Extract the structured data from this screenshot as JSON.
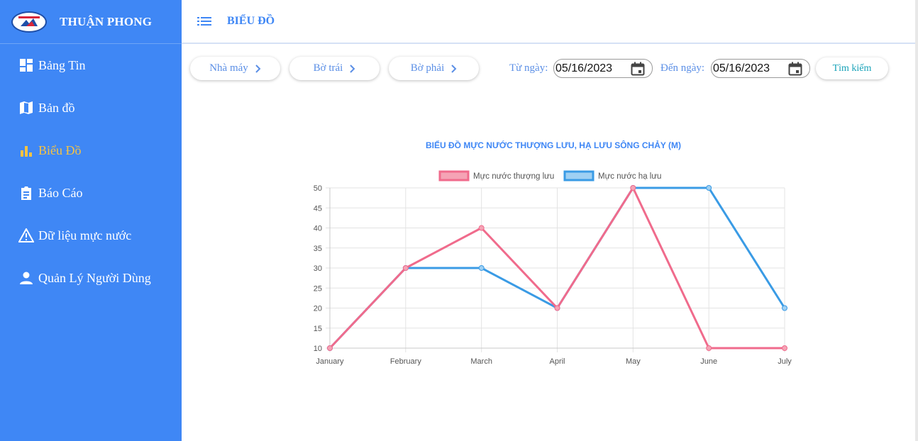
{
  "brand": {
    "name": "THUẬN PHONG"
  },
  "sidebar": {
    "items": [
      {
        "label": "Bảng Tin",
        "icon": "dashboard-icon"
      },
      {
        "label": "Bản đồ",
        "icon": "map-icon"
      },
      {
        "label": "Biểu Đồ",
        "icon": "bar-chart-icon",
        "active": true
      },
      {
        "label": "Báo Cáo",
        "icon": "clipboard-icon"
      },
      {
        "label": "Dữ liệu mực nước",
        "icon": "warning-icon"
      },
      {
        "label": "Quản Lý Người Dùng",
        "icon": "user-icon"
      }
    ]
  },
  "header": {
    "title": "BIỂU ĐỒ"
  },
  "toolbar": {
    "filters": [
      "Nhà máy",
      "Bờ trái",
      "Bờ phải"
    ],
    "from_label": "Từ ngày:",
    "from_value": "05/16/2023",
    "to_label": "Đến ngày:",
    "to_value": "05/16/2023",
    "search_label": "Tìm kiếm"
  },
  "colors": {
    "accent": "#3f87f5",
    "active": "#f6c343",
    "series_upper": "#f06b8c",
    "series_lower": "#3a9be5"
  },
  "chart_data": {
    "type": "line",
    "title": "BIỂU ĐỒ MỰC NƯỚC THƯỢNG LƯU, HẠ LƯU SÔNG CHẢY (M)",
    "categories": [
      "January",
      "February",
      "March",
      "April",
      "May",
      "June",
      "July"
    ],
    "series": [
      {
        "name": "Mực nước thượng lưu",
        "values": [
          10,
          30,
          40,
          20,
          50,
          10,
          10
        ],
        "color": "#f06b8c",
        "fill": "#f5a3b5"
      },
      {
        "name": "Mực nước hạ lưu",
        "values": [
          10,
          30,
          30,
          20,
          50,
          50,
          20
        ],
        "color": "#3a9be5",
        "fill": "#9fd0f3"
      }
    ],
    "ylim": [
      10,
      50
    ],
    "yticks": [
      10,
      15,
      20,
      25,
      30,
      35,
      40,
      45,
      50
    ],
    "grid": true,
    "legend": "top"
  }
}
